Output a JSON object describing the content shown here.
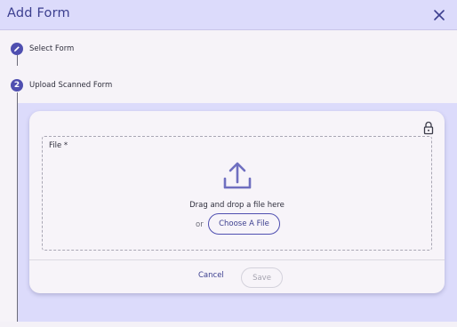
{
  "dialog": {
    "title": "Add Form",
    "close_icon": "close-icon"
  },
  "steps": [
    {
      "number": "",
      "icon": "pencil-icon",
      "label": "Select Form",
      "status": "completed"
    },
    {
      "number": "2",
      "label": "Upload Scanned Form",
      "status": "active"
    }
  ],
  "upload": {
    "lock_icon": "lock-icon",
    "field_label": "File *",
    "upload_icon": "upload-icon",
    "drag_text": "Drag and drop a file here",
    "or_text": "or",
    "choose_button": "Choose A File"
  },
  "actions": {
    "cancel_label": "Cancel",
    "save_label": "Save",
    "save_enabled": false
  },
  "colors": {
    "accent": "#4f4fb0",
    "header_bg": "#dcdbfb",
    "title_text": "#3c3f8f"
  }
}
